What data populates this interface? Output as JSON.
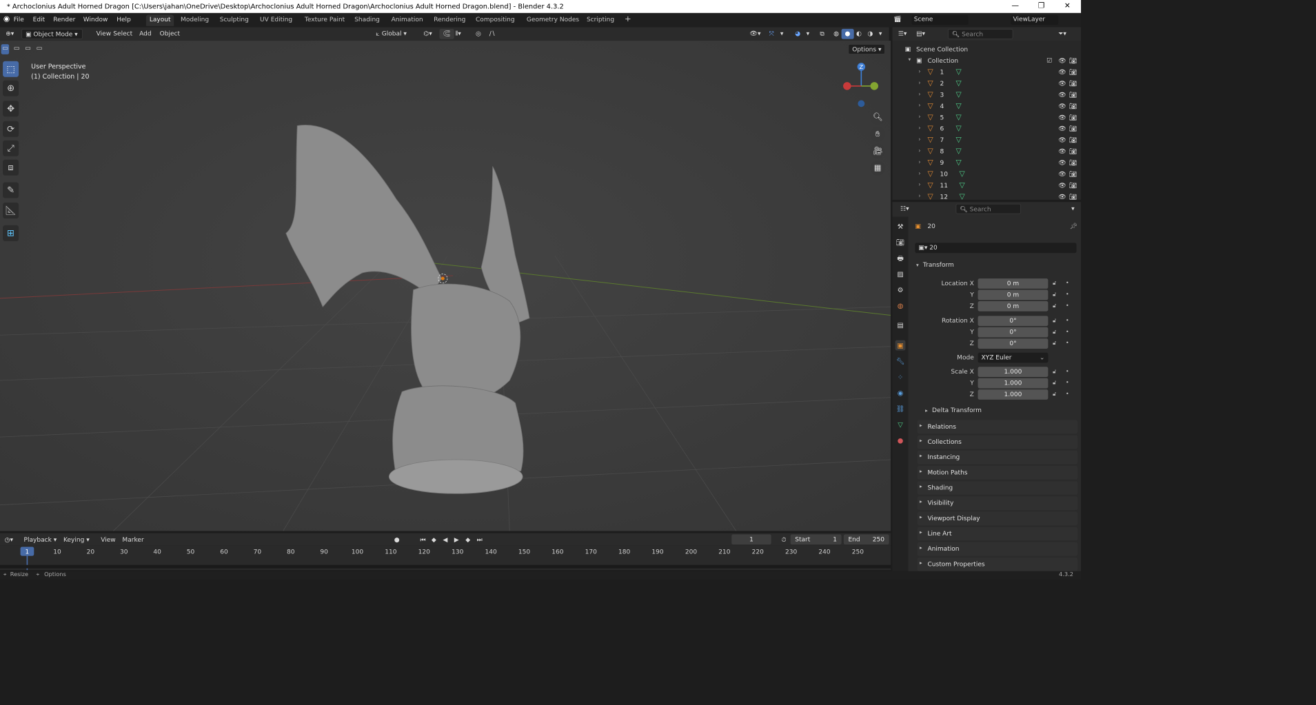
{
  "window": {
    "title": "* Archoclonius Adult Horned Dragon [C:\\Users\\jahan\\OneDrive\\Desktop\\Archoclonius Adult Horned Dragon\\Archoclonius Adult Horned Dragon.blend] - Blender 4.3.2"
  },
  "menu": [
    "File",
    "Edit",
    "Render",
    "Window",
    "Help"
  ],
  "workspaces": [
    "Layout",
    "Modeling",
    "Sculpting",
    "UV Editing",
    "Texture Paint",
    "Shading",
    "Animation",
    "Rendering",
    "Compositing",
    "Geometry Nodes",
    "Scripting"
  ],
  "active_workspace": "Layout",
  "scene_name": "Scene",
  "view_layer": "ViewLayer",
  "viewport_header": {
    "mode": "Object Mode",
    "menus": [
      "View",
      "Select",
      "Add",
      "Object"
    ],
    "orientation": "Global",
    "options": "Options"
  },
  "viewport": {
    "perspective": "User Perspective",
    "collection_info": "(1) Collection | 20",
    "gizmo_axis_label": "Z"
  },
  "outliner": {
    "search_placeholder": "Search",
    "scene_collection": "Scene Collection",
    "collection": "Collection",
    "objects": [
      "1",
      "2",
      "3",
      "4",
      "5",
      "6",
      "7",
      "8",
      "9",
      "10",
      "11",
      "12"
    ]
  },
  "properties": {
    "search_placeholder": "Search",
    "object_name": "20",
    "data_name": "20",
    "transform_title": "Transform",
    "location_label": "Location X",
    "rotation_label": "Rotation X",
    "scale_label": "Scale X",
    "y_label": "Y",
    "z_label": "Z",
    "mode_label": "Mode",
    "location": [
      "0 m",
      "0 m",
      "0 m"
    ],
    "rotation": [
      "0°",
      "0°",
      "0°"
    ],
    "mode_value": "XYZ Euler",
    "scale": [
      "1.000",
      "1.000",
      "1.000"
    ],
    "delta_transform": "Delta Transform",
    "panels": [
      "Relations",
      "Collections",
      "Instancing",
      "Motion Paths",
      "Shading",
      "Visibility",
      "Viewport Display",
      "Line Art",
      "Animation",
      "Custom Properties"
    ]
  },
  "timeline": {
    "menus": [
      "Playback",
      "Keying",
      "View",
      "Marker"
    ],
    "current_frame": "1",
    "start_label": "Start",
    "start": "1",
    "end_label": "End",
    "end": "250",
    "ticks": [
      "1",
      "10",
      "20",
      "30",
      "40",
      "50",
      "60",
      "70",
      "80",
      "90",
      "100",
      "110",
      "120",
      "130",
      "140",
      "150",
      "160",
      "170",
      "180",
      "190",
      "200",
      "210",
      "220",
      "230",
      "240",
      "250"
    ]
  },
  "statusbar": {
    "left1": "Resize",
    "left2": "Options",
    "version": "4.3.2"
  }
}
